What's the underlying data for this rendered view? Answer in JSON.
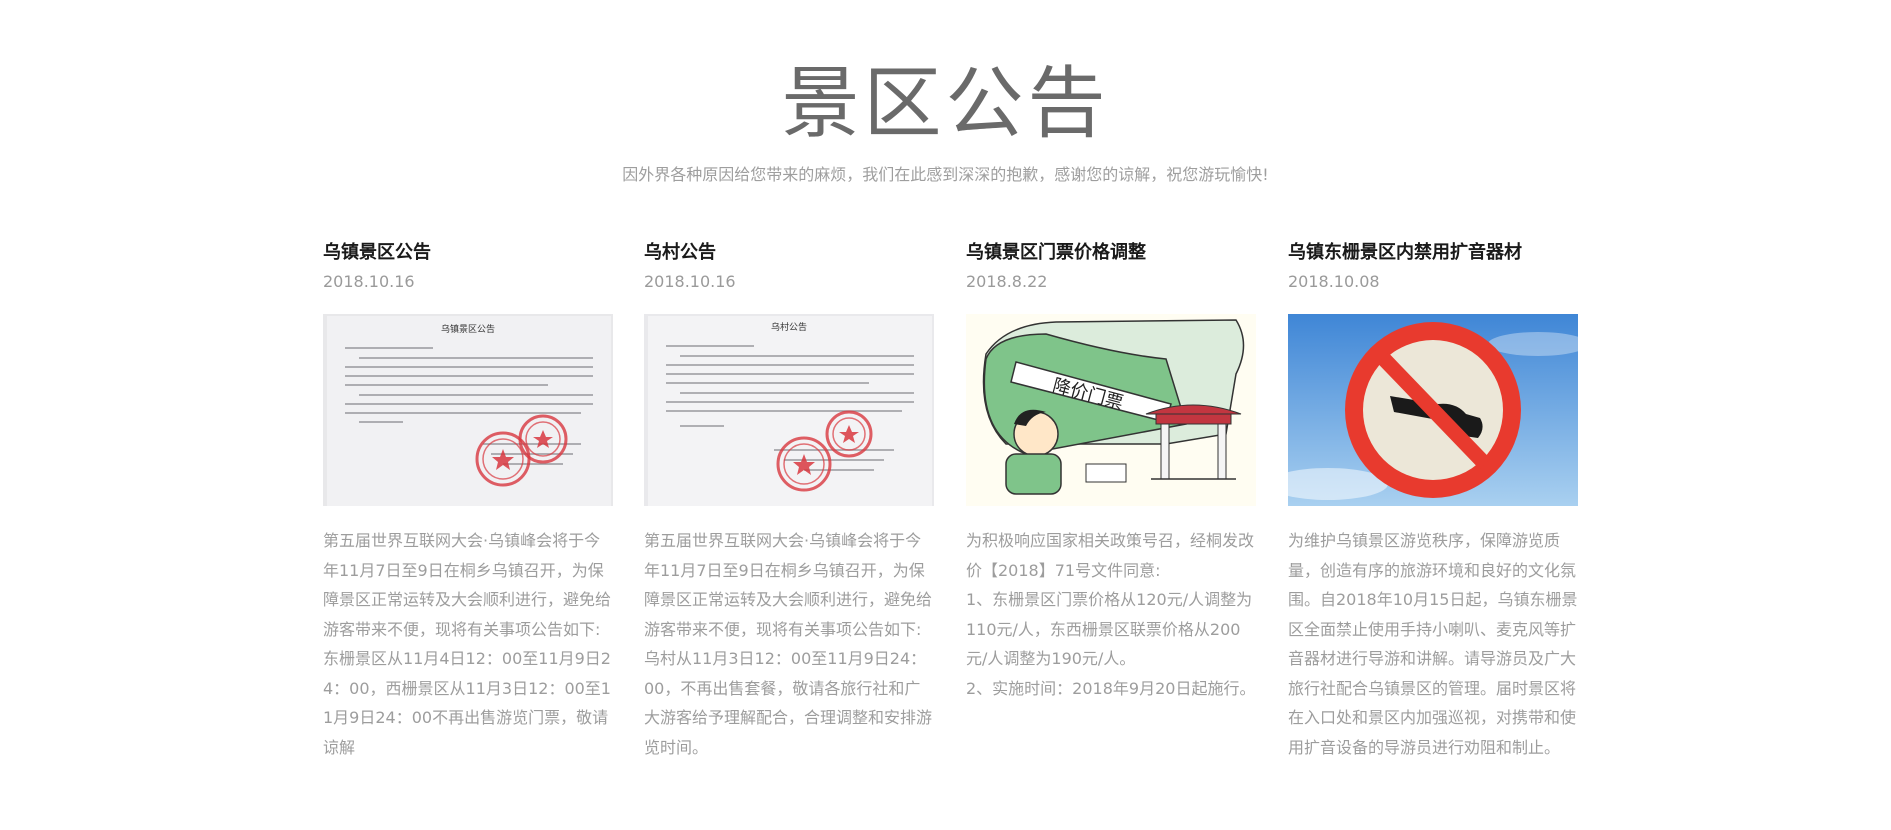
{
  "page": {
    "title": "景区公告",
    "subtitle": "因外界各种原因给您带来的麻烦，我们在此感到深深的抱歉，感谢您的谅解，祝您游玩愉快!"
  },
  "notices": [
    {
      "title": "乌镇景区公告",
      "date": "2018.10.16",
      "image_doc_title": "乌镇景区公告",
      "paragraphs": [
        "第五届世界互联网大会·乌镇峰会将于今年11月7日至9日在桐乡乌镇召开，为保障景区正常运转及大会顺利进行，避免给游客带来不便，现将有关事项公告如下:",
        "东栅景区从11月4日12：00至11月9日24：00，西栅景区从11月3日12：00至11月9日24：00不再出售游览门票，敬请谅解"
      ]
    },
    {
      "title": "乌村公告",
      "date": "2018.10.16",
      "image_doc_title": "乌村公告",
      "paragraphs": [
        "第五届世界互联网大会·乌镇峰会将于今年11月7日至9日在桐乡乌镇召开，为保障景区正常运转及大会顺利进行，避免给游客带来不便，现将有关事项公告如下:",
        "乌村从11月3日12：00至11月9日24：00，不再出售套餐，敬请各旅行社和广大游客给予理解配合，合理调整和安排游览时间。"
      ]
    },
    {
      "title": "乌镇景区门票价格调整",
      "date": "2018.8.22",
      "image_banner_text": "降价门票",
      "paragraphs": [
        "为积极响应国家相关政策号召，经桐发改价【2018】71号文件同意:",
        "1、东栅景区门票价格从120元/人调整为110元/人，东西栅景区联票价格从200元/人调整为190元/人。",
        "2、实施时间：2018年9月20日起施行。"
      ]
    },
    {
      "title": "乌镇东栅景区内禁用扩音器材",
      "date": "2018.10.08",
      "paragraphs": [
        "为维护乌镇景区游览秩序，保障游览质量，创造有序的旅游环境和良好的文化氛围。自2018年10月15日起，乌镇东栅景区全面禁止使用手持小喇叭、麦克风等扩音器材进行导游和讲解。请导游员及广大旅行社配合乌镇景区的管理。届时景区将在入口处和景区内加强巡视，对携带和使用扩音设备的导游员进行劝阻和制止。"
      ]
    }
  ],
  "colors": {
    "title": "#6a6a6a",
    "subtitle": "#9e9e9e",
    "card_title": "#1a1a1a",
    "body_text": "#9d9d9d",
    "stamp_red": "#d8373f",
    "sign_red": "#e83a2e",
    "sky_blue": "#4a8fd8"
  }
}
